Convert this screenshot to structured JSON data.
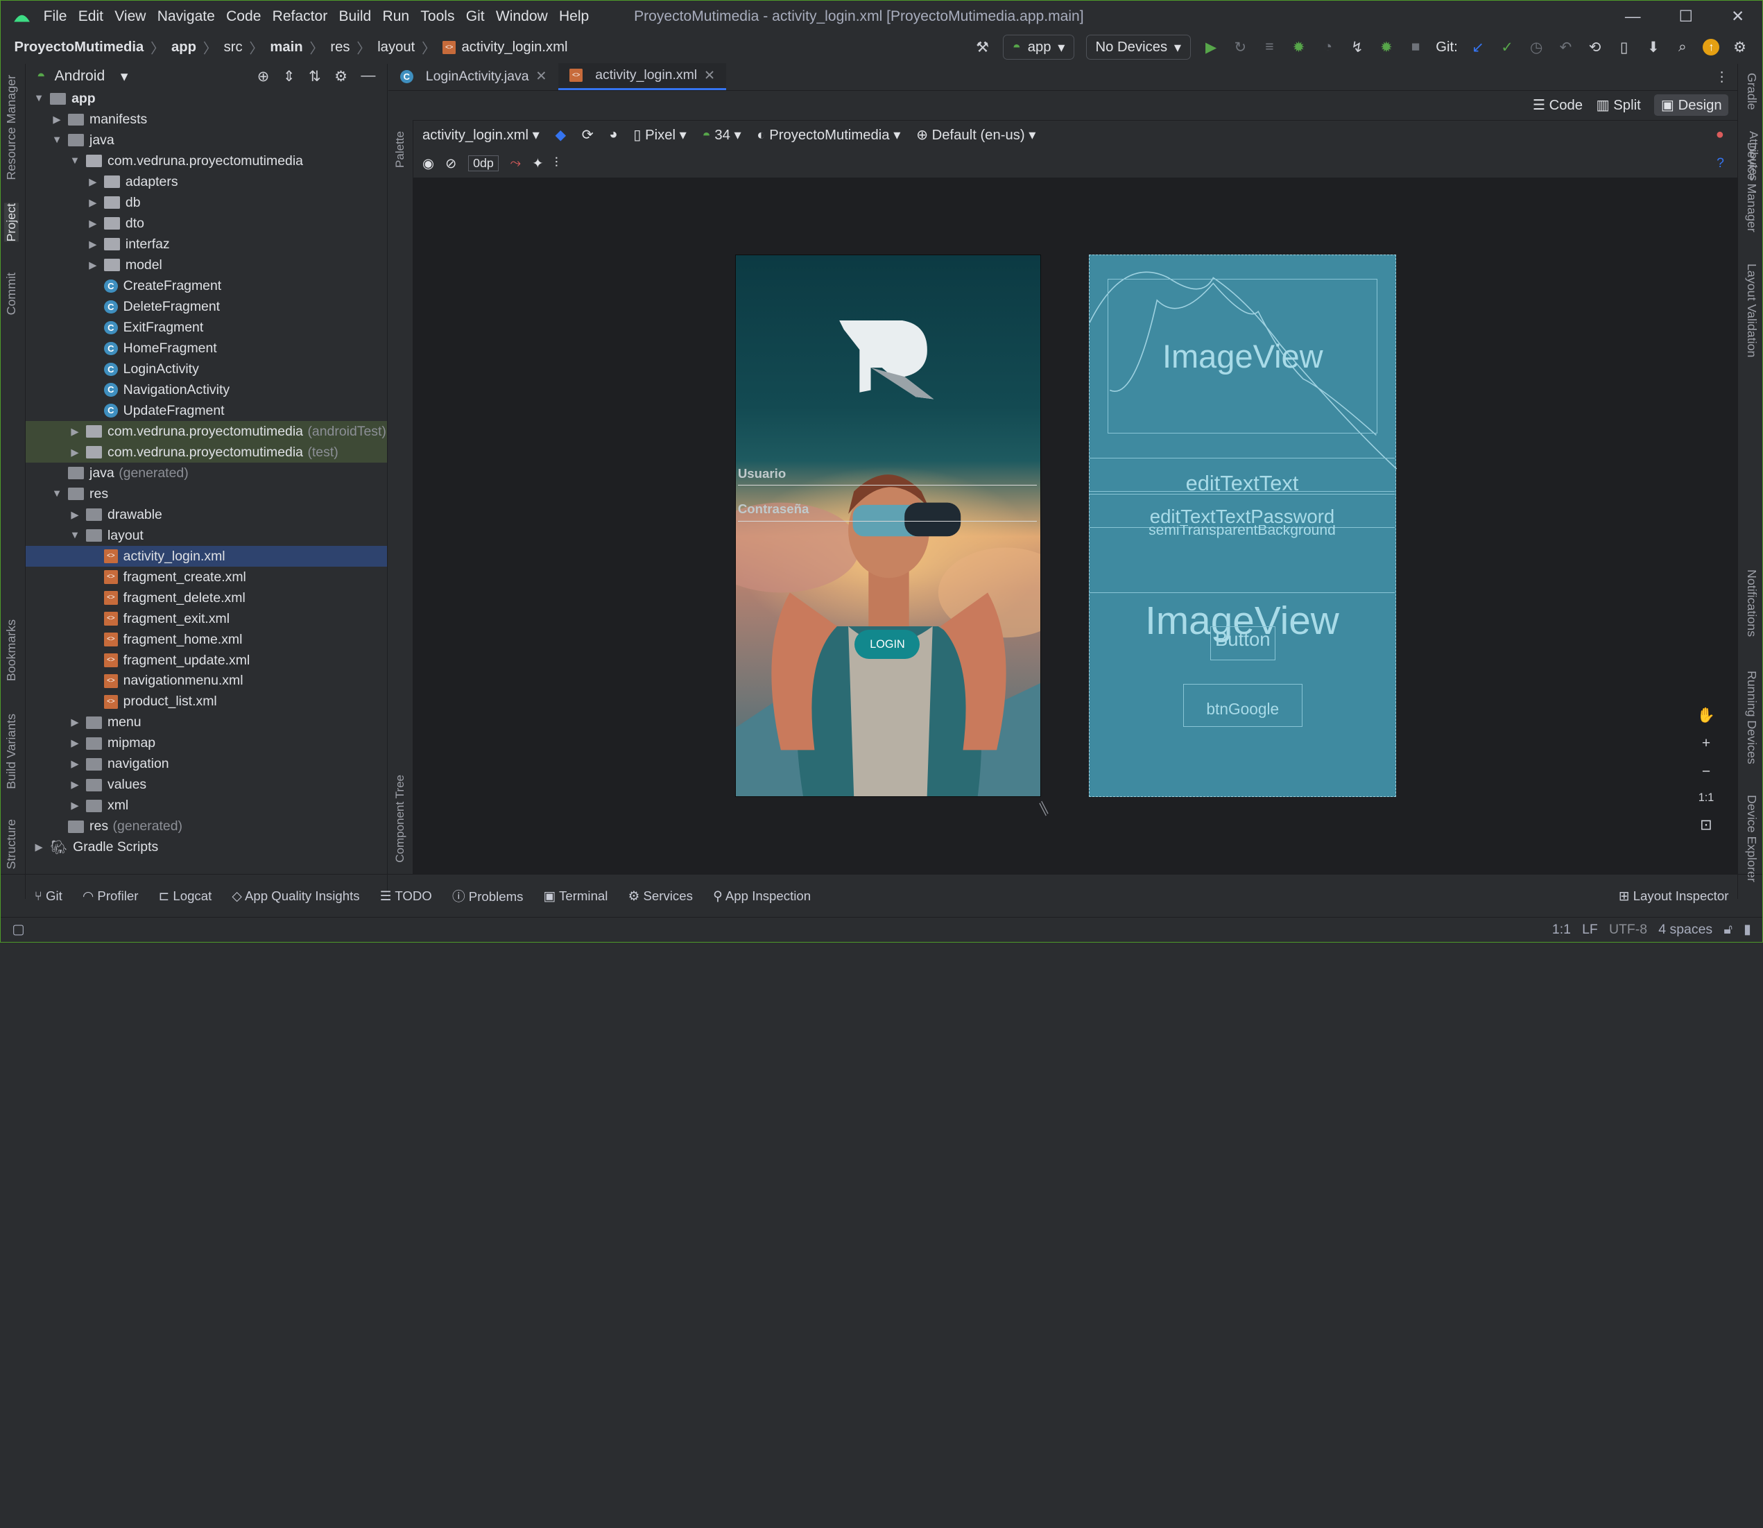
{
  "window": {
    "menu": [
      "File",
      "Edit",
      "View",
      "Navigate",
      "Code",
      "Refactor",
      "Build",
      "Run",
      "Tools",
      "Git",
      "Window",
      "Help"
    ],
    "title": "ProyectoMutimedia - activity_login.xml [ProyectoMutimedia.app.main]"
  },
  "breadcrumb": [
    "ProyectoMutimedia",
    "app",
    "src",
    "main",
    "res",
    "layout",
    "activity_login.xml"
  ],
  "toolbar": {
    "run_config": "app",
    "device": "No Devices",
    "git_label": "Git:"
  },
  "left_strip": [
    "Resource Manager",
    "Project",
    "Commit",
    "Bookmarks",
    "Build Variants",
    "Structure"
  ],
  "right_strip": [
    "Gradle",
    "Device Manager",
    "Layout Validation",
    "Notifications",
    "Running Devices",
    "Device Explorer"
  ],
  "project": {
    "view": "Android",
    "tree": [
      {
        "d": 0,
        "arr": "▼",
        "t": "fold",
        "label": "app",
        "b": true
      },
      {
        "d": 1,
        "arr": "▶",
        "t": "fold",
        "label": "manifests"
      },
      {
        "d": 1,
        "arr": "▼",
        "t": "fold",
        "label": "java"
      },
      {
        "d": 2,
        "arr": "▼",
        "t": "pkg",
        "label": "com.vedruna.proyectomutimedia"
      },
      {
        "d": 3,
        "arr": "▶",
        "t": "pkg",
        "label": "adapters"
      },
      {
        "d": 3,
        "arr": "▶",
        "t": "pkg",
        "label": "db"
      },
      {
        "d": 3,
        "arr": "▶",
        "t": "pkg",
        "label": "dto"
      },
      {
        "d": 3,
        "arr": "▶",
        "t": "pkg",
        "label": "interfaz"
      },
      {
        "d": 3,
        "arr": "▶",
        "t": "pkg",
        "label": "model"
      },
      {
        "d": 3,
        "arr": "",
        "t": "cls",
        "label": "CreateFragment"
      },
      {
        "d": 3,
        "arr": "",
        "t": "cls",
        "label": "DeleteFragment"
      },
      {
        "d": 3,
        "arr": "",
        "t": "cls",
        "label": "ExitFragment"
      },
      {
        "d": 3,
        "arr": "",
        "t": "cls",
        "label": "HomeFragment"
      },
      {
        "d": 3,
        "arr": "",
        "t": "cls",
        "label": "LoginActivity"
      },
      {
        "d": 3,
        "arr": "",
        "t": "cls",
        "label": "NavigationActivity"
      },
      {
        "d": 3,
        "arr": "",
        "t": "cls",
        "label": "UpdateFragment"
      },
      {
        "d": 2,
        "arr": "▶",
        "t": "pkg",
        "label": "com.vedruna.proyectomutimedia",
        "suffix": "(androidTest)",
        "hl": true
      },
      {
        "d": 2,
        "arr": "▶",
        "t": "pkg",
        "label": "com.vedruna.proyectomutimedia",
        "suffix": "(test)",
        "hl": true
      },
      {
        "d": 1,
        "arr": "",
        "t": "fold",
        "label": "java",
        "suffix": "(generated)"
      },
      {
        "d": 1,
        "arr": "▼",
        "t": "fold",
        "label": "res"
      },
      {
        "d": 2,
        "arr": "▶",
        "t": "fold",
        "label": "drawable"
      },
      {
        "d": 2,
        "arr": "▼",
        "t": "fold",
        "label": "layout"
      },
      {
        "d": 3,
        "arr": "",
        "t": "xml",
        "label": "activity_login.xml",
        "sel": true
      },
      {
        "d": 3,
        "arr": "",
        "t": "xml",
        "label": "fragment_create.xml"
      },
      {
        "d": 3,
        "arr": "",
        "t": "xml",
        "label": "fragment_delete.xml"
      },
      {
        "d": 3,
        "arr": "",
        "t": "xml",
        "label": "fragment_exit.xml"
      },
      {
        "d": 3,
        "arr": "",
        "t": "xml",
        "label": "fragment_home.xml"
      },
      {
        "d": 3,
        "arr": "",
        "t": "xml",
        "label": "fragment_update.xml"
      },
      {
        "d": 3,
        "arr": "",
        "t": "xml",
        "label": "navigationmenu.xml"
      },
      {
        "d": 3,
        "arr": "",
        "t": "xml",
        "label": "product_list.xml"
      },
      {
        "d": 2,
        "arr": "▶",
        "t": "fold",
        "label": "menu"
      },
      {
        "d": 2,
        "arr": "▶",
        "t": "fold",
        "label": "mipmap"
      },
      {
        "d": 2,
        "arr": "▶",
        "t": "fold",
        "label": "navigation"
      },
      {
        "d": 2,
        "arr": "▶",
        "t": "fold",
        "label": "values"
      },
      {
        "d": 2,
        "arr": "▶",
        "t": "fold",
        "label": "xml"
      },
      {
        "d": 1,
        "arr": "",
        "t": "fold",
        "label": "res",
        "suffix": "(generated)"
      },
      {
        "d": 0,
        "arr": "▶",
        "t": "gradle",
        "label": "Gradle Scripts"
      }
    ]
  },
  "editor": {
    "tabs": [
      "LoginActivity.java",
      "activity_login.xml"
    ],
    "modes": [
      "Code",
      "Split",
      "Design"
    ],
    "design_toolbar": {
      "file": "activity_login.xml",
      "device": "Pixel",
      "api": "34",
      "theme": "ProyectoMutimedia",
      "locale": "Default (en-us)",
      "margin": "0dp"
    },
    "palette_label": "Palette",
    "tree_label": "Component Tree",
    "attributes_label": "Attributes"
  },
  "preview": {
    "usuario": "Usuario",
    "contrasena": "Contraseña",
    "login": "LOGIN"
  },
  "blueprint": {
    "image1": "ImageView",
    "edit1": "editTextText",
    "edit2": "editTextTextPassword",
    "bg": "semiTransparentBackground",
    "image2": "ImageView",
    "button": "Button",
    "google": "btnGoogle"
  },
  "zoom": {
    "one_to_one": "1:1"
  },
  "tool_windows": [
    "Git",
    "Profiler",
    "Logcat",
    "App Quality Insights",
    "TODO",
    "Problems",
    "Terminal",
    "Services",
    "App Inspection"
  ],
  "layout_inspector": "Layout Inspector",
  "status": {
    "pos": "1:1",
    "lf": "LF",
    "enc": "UTF-8",
    "indent": "4 spaces"
  }
}
